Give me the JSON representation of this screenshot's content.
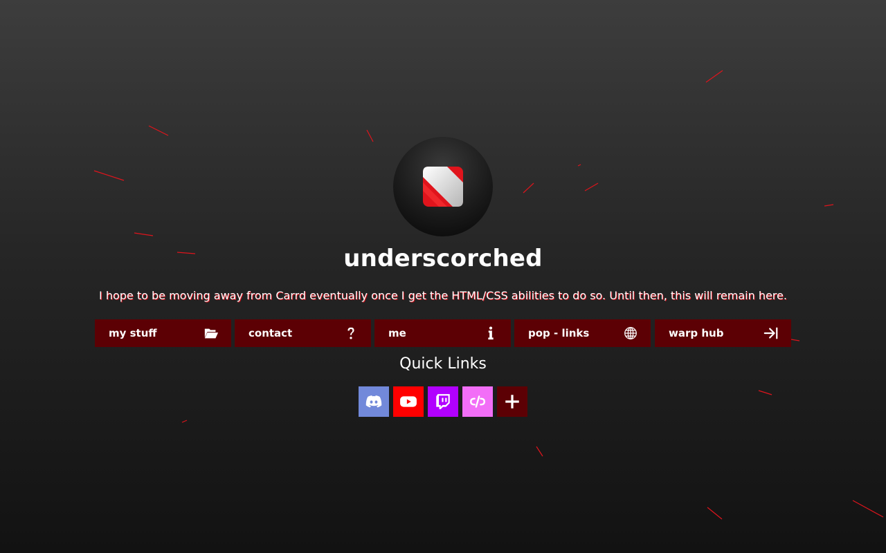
{
  "profile": {
    "name": "underscorched",
    "tagline": "I hope to be moving away from Carrd eventually once I get the HTML/CSS abilities to do so. Until then, this will remain here."
  },
  "nav": [
    {
      "label": "my stuff",
      "icon": "folder-open-icon"
    },
    {
      "label": "contact",
      "icon": "question-icon"
    },
    {
      "label": "me",
      "icon": "info-icon"
    },
    {
      "label": "pop - links",
      "icon": "globe-icon"
    },
    {
      "label": "warp hub",
      "icon": "arrow-to-right-icon"
    }
  ],
  "quick_links": {
    "title": "Quick Links",
    "items": [
      {
        "icon": "discord-icon",
        "color": "#7289da"
      },
      {
        "icon": "youtube-icon",
        "color": "#ff0000"
      },
      {
        "icon": "twitch-icon",
        "color": "#b100ff"
      },
      {
        "icon": "picarto-icon",
        "color": "#f26ef7"
      },
      {
        "icon": "plus-icon",
        "color": "#5c0004"
      }
    ]
  },
  "colors": {
    "button_bg": "#5c0004",
    "accent": "#e0141c"
  }
}
